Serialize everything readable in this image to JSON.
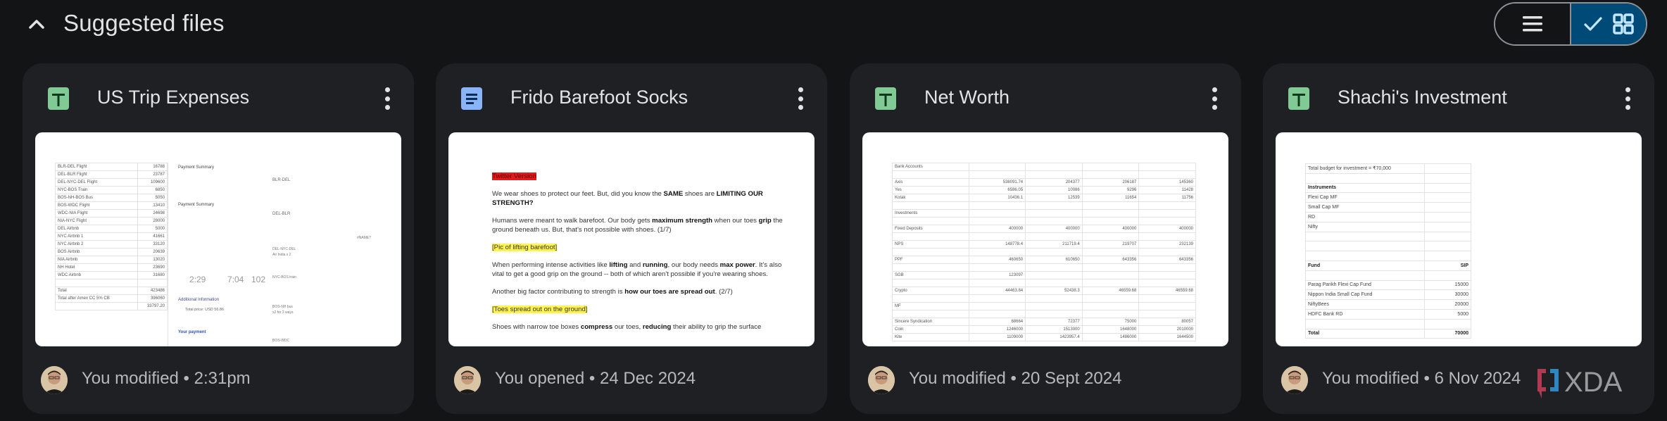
{
  "header": {
    "title": "Suggested files",
    "collapse_icon": "chevron-up-icon",
    "view_toggle": {
      "list_icon": "list-view-icon",
      "grid_selected_icon": "check-icon",
      "grid_icon": "grid-view-icon",
      "selected": "grid"
    }
  },
  "colors": {
    "background": "#131416",
    "card": "#1f2023",
    "sheet_icon": "#81c995",
    "doc_icon": "#8ab4f8",
    "toggle_selected": "#004a77"
  },
  "cards": [
    {
      "type": "spreadsheet",
      "icon": "google-sheets-icon",
      "title": "US Trip Expenses",
      "activity": "You modified • 2:31pm",
      "preview": {
        "rows": [
          [
            "BLR-DEL Flight",
            "16788"
          ],
          [
            "DEL-BLR Flight",
            "23787"
          ],
          [
            "DEL-NYC-DEL Flight",
            "109600"
          ],
          [
            "NYC-BOS Train",
            "6850"
          ],
          [
            "BOS-NH-BOS Bus",
            "5050"
          ],
          [
            "BOS-WDC Flight",
            "13410"
          ],
          [
            "WDC-NIA Flight",
            "24698"
          ],
          [
            "NIA-NYC Flight",
            "28000"
          ],
          [
            "DEL Airbnb",
            "5000"
          ],
          [
            "NYC Airbnb 1",
            "41661"
          ],
          [
            "NYC Airbnb 2",
            "33120"
          ],
          [
            "BOS Airbnb",
            "20639"
          ],
          [
            "NIA Airbnb",
            "13020"
          ],
          [
            "NH Hotel",
            "23690"
          ],
          [
            "WDC Airbnb",
            "31680"
          ],
          [
            "",
            ""
          ],
          [
            "Total",
            "423486"
          ],
          [
            "Total after Amex CC 5% CB",
            "396060"
          ],
          [
            "",
            "33797.20"
          ]
        ],
        "payment_summary_label": "Payment Summary",
        "notes": [
          "BLR-DEL",
          "DEL-BLR",
          "DEL-NYC-DEL",
          "Air India x 2",
          "NYC-BOS train",
          "BOS-NH bus",
          "x2 for 2 ways",
          "BOS-WDC",
          "#NAME?"
        ],
        "additional_info": "Additional Information",
        "total_price": "Total price: USD 56.86",
        "your_payment": "Your payment",
        "times": [
          "2:29",
          "7:04",
          "102"
        ]
      }
    },
    {
      "type": "document",
      "icon": "google-docs-icon",
      "title": "Frido Barefoot Socks",
      "activity": "You opened • 24 Dec 2024",
      "preview": {
        "heading_tag": "Twitter Version",
        "p1_a": "We wear shoes to protect our feet. But, did you know the ",
        "p1_b": "SAME",
        "p1_c": " shoes are ",
        "p1_d": "LIMITING OUR STRENGTH?",
        "p2_a": "Humans were meant to walk barefoot. Our body gets ",
        "p2_b": "maximum strength",
        "p2_c": " when our toes ",
        "p2_d": "grip",
        "p2_e": " the ground beneath us. But, that's not possible with shoes. (1/7)",
        "tag1": "[Pic of lifting barefoot]",
        "p3_a": "When performing intense activities like ",
        "p3_b": "lifting",
        "p3_c": " and ",
        "p3_d": "running",
        "p3_e": ", our body needs ",
        "p3_f": "max power",
        "p3_g": ". It's also vital to get a good grip on the ground -- both of which aren't possible if you're wearing shoes.",
        "p4_a": "Another big factor contributing to strength is ",
        "p4_b": "how our toes are spread out",
        "p4_c": ". (2/7)",
        "tag2": "[Toes spread out on the ground]",
        "p5_a": "Shoes with narrow toe boxes ",
        "p5_b": "compress",
        "p5_c": " our toes, ",
        "p5_d": "reducing",
        "p5_e": " their ability to grip the surface"
      }
    },
    {
      "type": "spreadsheet",
      "icon": "google-sheets-icon",
      "title": "Net Worth",
      "activity": "You modified • 20 Sept 2024",
      "preview": {
        "rows": [
          [
            "Bank Accounts",
            "",
            "",
            "",
            ""
          ],
          [
            "",
            "",
            "",
            "",
            ""
          ],
          [
            "Axis",
            "538091.74",
            "204377",
            "206187",
            "145360"
          ],
          [
            "Yes",
            "6586.05",
            "10086",
            "9296",
            "11428"
          ],
          [
            "Kotak",
            "10436.1",
            "12539",
            "11654",
            "11756"
          ],
          [
            "",
            "",
            "",
            "",
            ""
          ],
          [
            "Investments",
            "",
            "",
            "",
            ""
          ],
          [
            "",
            "",
            "",
            "",
            ""
          ],
          [
            "Fixed Deposits",
            "400000",
            "400000",
            "400000",
            "400000"
          ],
          [
            "",
            "",
            "",
            "",
            ""
          ],
          [
            "NPS",
            "148778.4",
            "211719.4",
            "219707",
            "232139"
          ],
          [
            "",
            "",
            "",
            "",
            ""
          ],
          [
            "PPF",
            "460650",
            "610650",
            "643356",
            "643356"
          ],
          [
            "",
            "",
            "",
            "",
            ""
          ],
          [
            "SGB",
            "123097",
            "",
            "",
            ""
          ],
          [
            "",
            "",
            "",
            "",
            ""
          ],
          [
            "Crypto",
            "44463.84",
            "52438.3",
            "46559.68",
            "46559.68"
          ],
          [
            "",
            "",
            "",
            "",
            ""
          ],
          [
            "MF",
            "",
            "",
            "",
            ""
          ],
          [
            "",
            "",
            "",
            "",
            ""
          ],
          [
            "Sincere Syndication",
            "68664",
            "72377",
            "75000",
            "80057"
          ],
          [
            "Coin",
            "1246000",
            "1513000",
            "1648000",
            "2010000"
          ],
          [
            "Kite",
            "1109000",
            "1423957.4",
            "1486000",
            "1644500"
          ]
        ]
      }
    },
    {
      "type": "spreadsheet",
      "icon": "google-sheets-icon",
      "title": "Shachi's Investment",
      "activity": "You modified • 6 Nov 2024",
      "preview": {
        "rows": [
          [
            "Total budget for investment = ₹70,000",
            "",
            ""
          ],
          [
            "",
            "",
            ""
          ],
          [
            "Instruments",
            "",
            "bold"
          ],
          [
            "Flexi Cap MF",
            "",
            ""
          ],
          [
            "Small Cap MF",
            "",
            ""
          ],
          [
            "RD",
            "",
            ""
          ],
          [
            "Nifty",
            "",
            ""
          ],
          [
            "",
            "",
            ""
          ],
          [
            "",
            "",
            ""
          ],
          [
            "",
            "",
            ""
          ],
          [
            "Fund",
            "SIP",
            "bold"
          ],
          [
            "",
            "",
            ""
          ],
          [
            "Parag Parikh Flexi Cap Fund",
            "15000",
            ""
          ],
          [
            "Nippon India Small Cap Fund",
            "30000",
            ""
          ],
          [
            "NiftyBees",
            "20000",
            ""
          ],
          [
            "HDFC Bank RD",
            "5000",
            ""
          ],
          [
            "",
            "",
            ""
          ],
          [
            "Total",
            "70000",
            "bold"
          ]
        ]
      }
    }
  ],
  "watermark": "XDA"
}
